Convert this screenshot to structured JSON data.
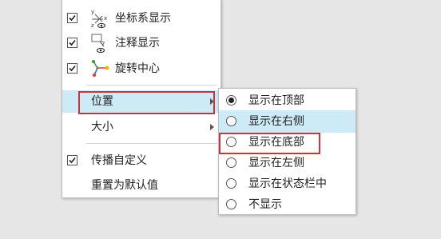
{
  "main_menu": {
    "items": [
      {
        "label": "坐标系显示",
        "checked": true,
        "icon": "coordinate-system-icon"
      },
      {
        "label": "注释显示",
        "checked": true,
        "icon": "annotation-icon"
      },
      {
        "label": "旋转中心",
        "checked": true,
        "icon": "spin-center-icon"
      },
      {
        "label": "位置",
        "submenu": true,
        "highlighted": true
      },
      {
        "label": "大小",
        "submenu": true
      },
      {
        "label": "传播自定义",
        "checked": true
      },
      {
        "label": "重置为默认值"
      }
    ]
  },
  "position_submenu": {
    "options": [
      {
        "label": "显示在顶部",
        "selected": true
      },
      {
        "label": "显示在右侧",
        "highlighted": true
      },
      {
        "label": "显示在底部"
      },
      {
        "label": "显示在左侧"
      },
      {
        "label": "显示在状态栏中"
      },
      {
        "label": "不显示"
      }
    ]
  },
  "colors": {
    "highlight": "#cdeaf7",
    "annotation_box": "#d32f3a"
  }
}
